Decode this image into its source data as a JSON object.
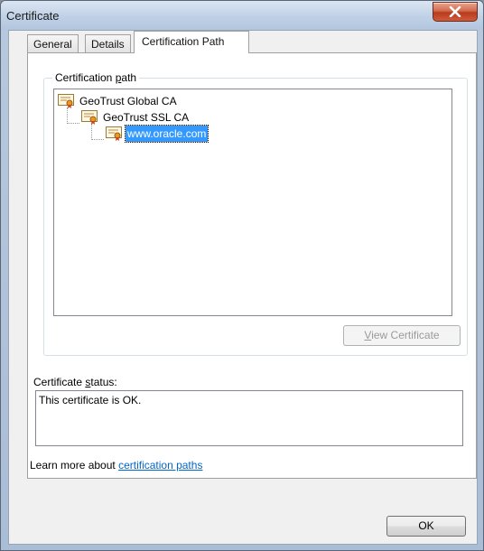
{
  "window": {
    "title": "Certificate"
  },
  "tabs": [
    {
      "label": "General"
    },
    {
      "label": "Details"
    },
    {
      "label": "Certification Path"
    }
  ],
  "path_group": {
    "label_pre": "Certification ",
    "label_key": "p",
    "label_post": "ath",
    "nodes": [
      {
        "label": "GeoTrust Global CA"
      },
      {
        "label": "GeoTrust SSL CA"
      },
      {
        "label": "www.oracle.com"
      }
    ],
    "view_button": {
      "key": "V",
      "rest": "iew Certificate"
    }
  },
  "status": {
    "label_pre": "Certificate ",
    "label_key": "s",
    "label_post": "tatus:",
    "text": "This certificate is OK."
  },
  "learn": {
    "prefix": "Learn more about ",
    "link": "certification paths"
  },
  "ok_button": "OK",
  "icons": {
    "cert": "certificate-icon",
    "close": "close-icon"
  }
}
